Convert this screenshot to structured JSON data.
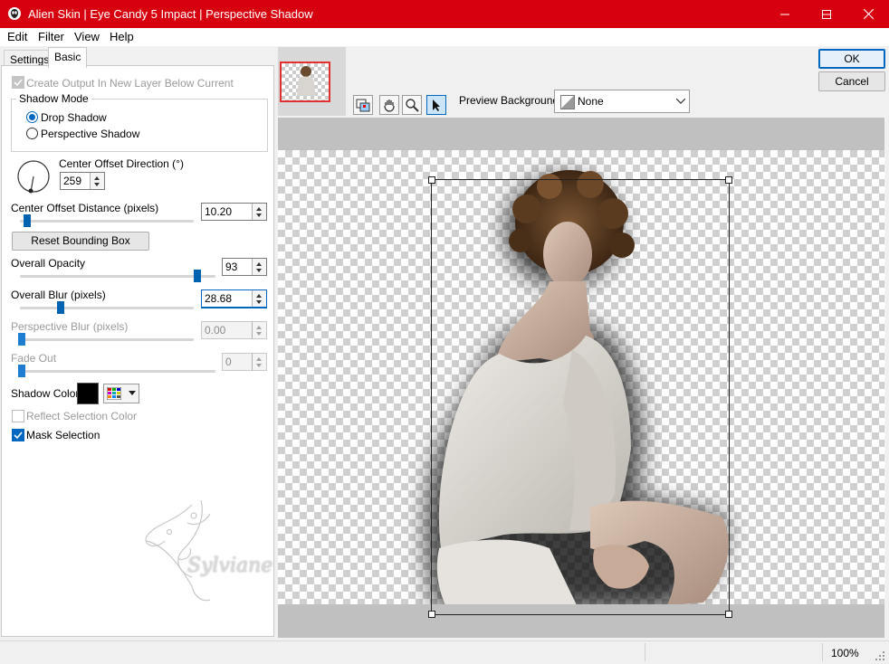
{
  "window": {
    "title": "Alien Skin | Eye Candy 5 Impact | Perspective Shadow"
  },
  "menubar": {
    "items": [
      "Edit",
      "Filter",
      "View",
      "Help"
    ]
  },
  "tabs": [
    "Settings",
    "Basic"
  ],
  "options": {
    "create_output_label": "Create Output In New Layer Below Current",
    "create_output_checked": true,
    "shadow_mode_label": "Shadow Mode",
    "drop_shadow_label": "Drop Shadow",
    "perspective_shadow_label": "Perspective Shadow",
    "selected_mode": "Drop Shadow",
    "center_offset_direction_label": "Center Offset Direction (°)",
    "center_offset_direction": "259",
    "center_offset_distance_label": "Center Offset Distance (pixels)",
    "center_offset_distance": "10.20",
    "reset_bounding_box_label": "Reset Bounding Box",
    "overall_opacity_label": "Overall Opacity",
    "overall_opacity": "93",
    "overall_blur_label": "Overall Blur (pixels)",
    "overall_blur": "28.68",
    "perspective_blur_label": "Perspective Blur (pixels)",
    "perspective_blur": "0.00",
    "fade_out_label": "Fade Out",
    "fade_out": "0",
    "shadow_color_label": "Shadow Color",
    "shadow_color": "#000000",
    "reflect_selection_color_label": "Reflect Selection Color",
    "reflect_selection_color_checked": false,
    "mask_selection_label": "Mask Selection",
    "mask_selection_checked": true
  },
  "watermark": {
    "text": "Sylviane"
  },
  "preview": {
    "background_label": "Preview Background:",
    "background_value": "None",
    "tools": [
      "navigator-icon",
      "hand-icon",
      "zoom-icon",
      "arrow-pointer-icon"
    ]
  },
  "buttons": {
    "ok": "OK",
    "cancel": "Cancel"
  },
  "status": {
    "zoom": "100%"
  },
  "colors": {
    "titlebar": "#d7000f",
    "accent": "#0067c0"
  }
}
